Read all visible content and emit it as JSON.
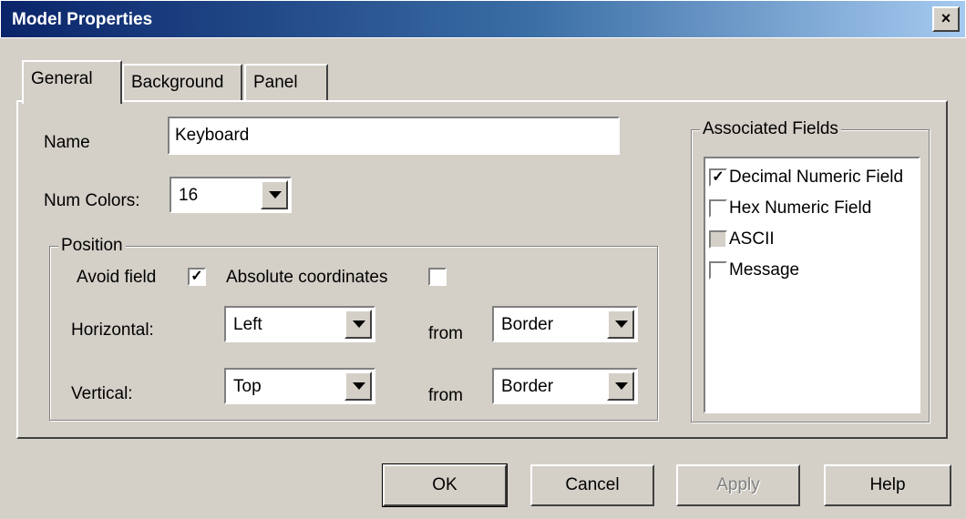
{
  "window": {
    "title": "Model Properties",
    "close_label": "×"
  },
  "tabs": [
    {
      "label": "General",
      "active": true
    },
    {
      "label": "Background",
      "active": false
    },
    {
      "label": "Panel",
      "active": false
    }
  ],
  "general": {
    "name_label": "Name",
    "name_value": "Keyboard",
    "num_colors_label": "Num Colors:",
    "num_colors_value": "16"
  },
  "position": {
    "group_label": "Position",
    "avoid_field_label": "Avoid field",
    "avoid_field_checked": true,
    "absolute_coords_label": "Absolute coordinates",
    "absolute_coords_checked": false,
    "horizontal_label": "Horizontal:",
    "horizontal_value": "Left",
    "horizontal_from_label": "from",
    "horizontal_from_value": "Border",
    "vertical_label": "Vertical:",
    "vertical_value": "Top",
    "vertical_from_label": "from",
    "vertical_from_value": "Border"
  },
  "associated": {
    "group_label": "Associated Fields",
    "items": [
      {
        "label": "Decimal Numeric Field",
        "checked": true,
        "enabled": true
      },
      {
        "label": "Hex Numeric Field",
        "checked": false,
        "enabled": true
      },
      {
        "label": "ASCII",
        "checked": false,
        "enabled": false
      },
      {
        "label": "Message",
        "checked": false,
        "enabled": true
      }
    ]
  },
  "buttons": {
    "ok": "OK",
    "cancel": "Cancel",
    "apply": "Apply",
    "help": "Help"
  },
  "check_glyph": "✓"
}
